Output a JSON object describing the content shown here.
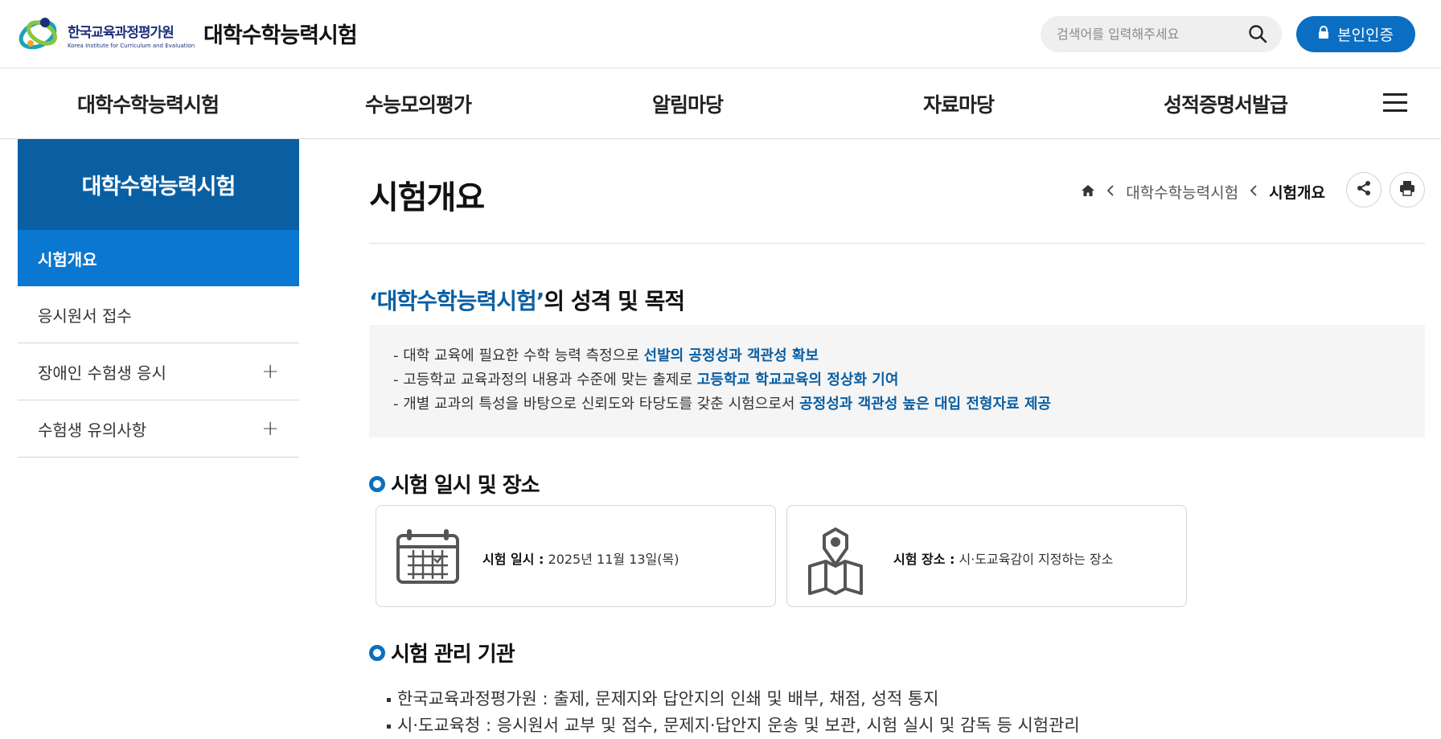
{
  "header": {
    "logo_kr": "한국교육과정평가원",
    "logo_en": "Korea Institute for Curriculum and Evaluation",
    "site_title": "대학수학능력시험",
    "search_placeholder": "검색어를 입력해주세요",
    "auth_label": "본인인증"
  },
  "gnb": {
    "items": [
      {
        "label": "대학수학능력시험"
      },
      {
        "label": "수능모의평가"
      },
      {
        "label": "알림마당"
      },
      {
        "label": "자료마당"
      },
      {
        "label": "성적증명서발급"
      }
    ]
  },
  "lnb": {
    "title": "대학수학능력시험",
    "items": [
      {
        "label": "시험개요",
        "active": true
      },
      {
        "label": "응시원서 접수"
      },
      {
        "label": "장애인 수험생 응시",
        "expandable": true
      },
      {
        "label": "수험생 유의사항",
        "expandable": true
      }
    ]
  },
  "page": {
    "title": "시험개요",
    "breadcrumb": {
      "level1": "대학수학능력시험",
      "current": "시험개요"
    }
  },
  "purpose": {
    "title_highlight": "‘대학수학능력시험’",
    "title_rest": "의 성격 및 목적",
    "lines": [
      {
        "text": "-  대학 교육에 필요한 수학 능력 측정으로 ",
        "emphasis": "선발의 공정성과 객관성 확보"
      },
      {
        "text": "-  고등학교 교육과정의 내용과 수준에 맞는 출제로 ",
        "emphasis": "고등학교 학교교육의 정상화 기여"
      },
      {
        "text": "-  개별 교과의 특성을 바탕으로 신뢰도와 타당도를 갖춘 시험으로서 ",
        "emphasis": "공정성과 객관성 높은 대입 전형자료 제공"
      }
    ]
  },
  "schedule": {
    "title": "시험 일시 및 장소",
    "date_label": "시험 일시 :",
    "date_value": " 2025년 11월 13일(목)",
    "place_label": "시험 장소 :",
    "place_value": " 시·도교육감이 지정하는 장소"
  },
  "management": {
    "title": "시험 관리 기관",
    "items": [
      "한국교육과정평가원 : 출제, 문제지와 답안지의 인쇄 및 배부, 채점, 성적 통지",
      "시·도교육청 : 응시원서 교부 및 접수, 문제지·답안지 운송 및 보관, 시험 실시 및 감독 등 시험관리"
    ]
  },
  "colors": {
    "primary": "#0a6fc2",
    "lnb_head": "#0a5fa3",
    "lnb_active": "#0a78d0"
  }
}
